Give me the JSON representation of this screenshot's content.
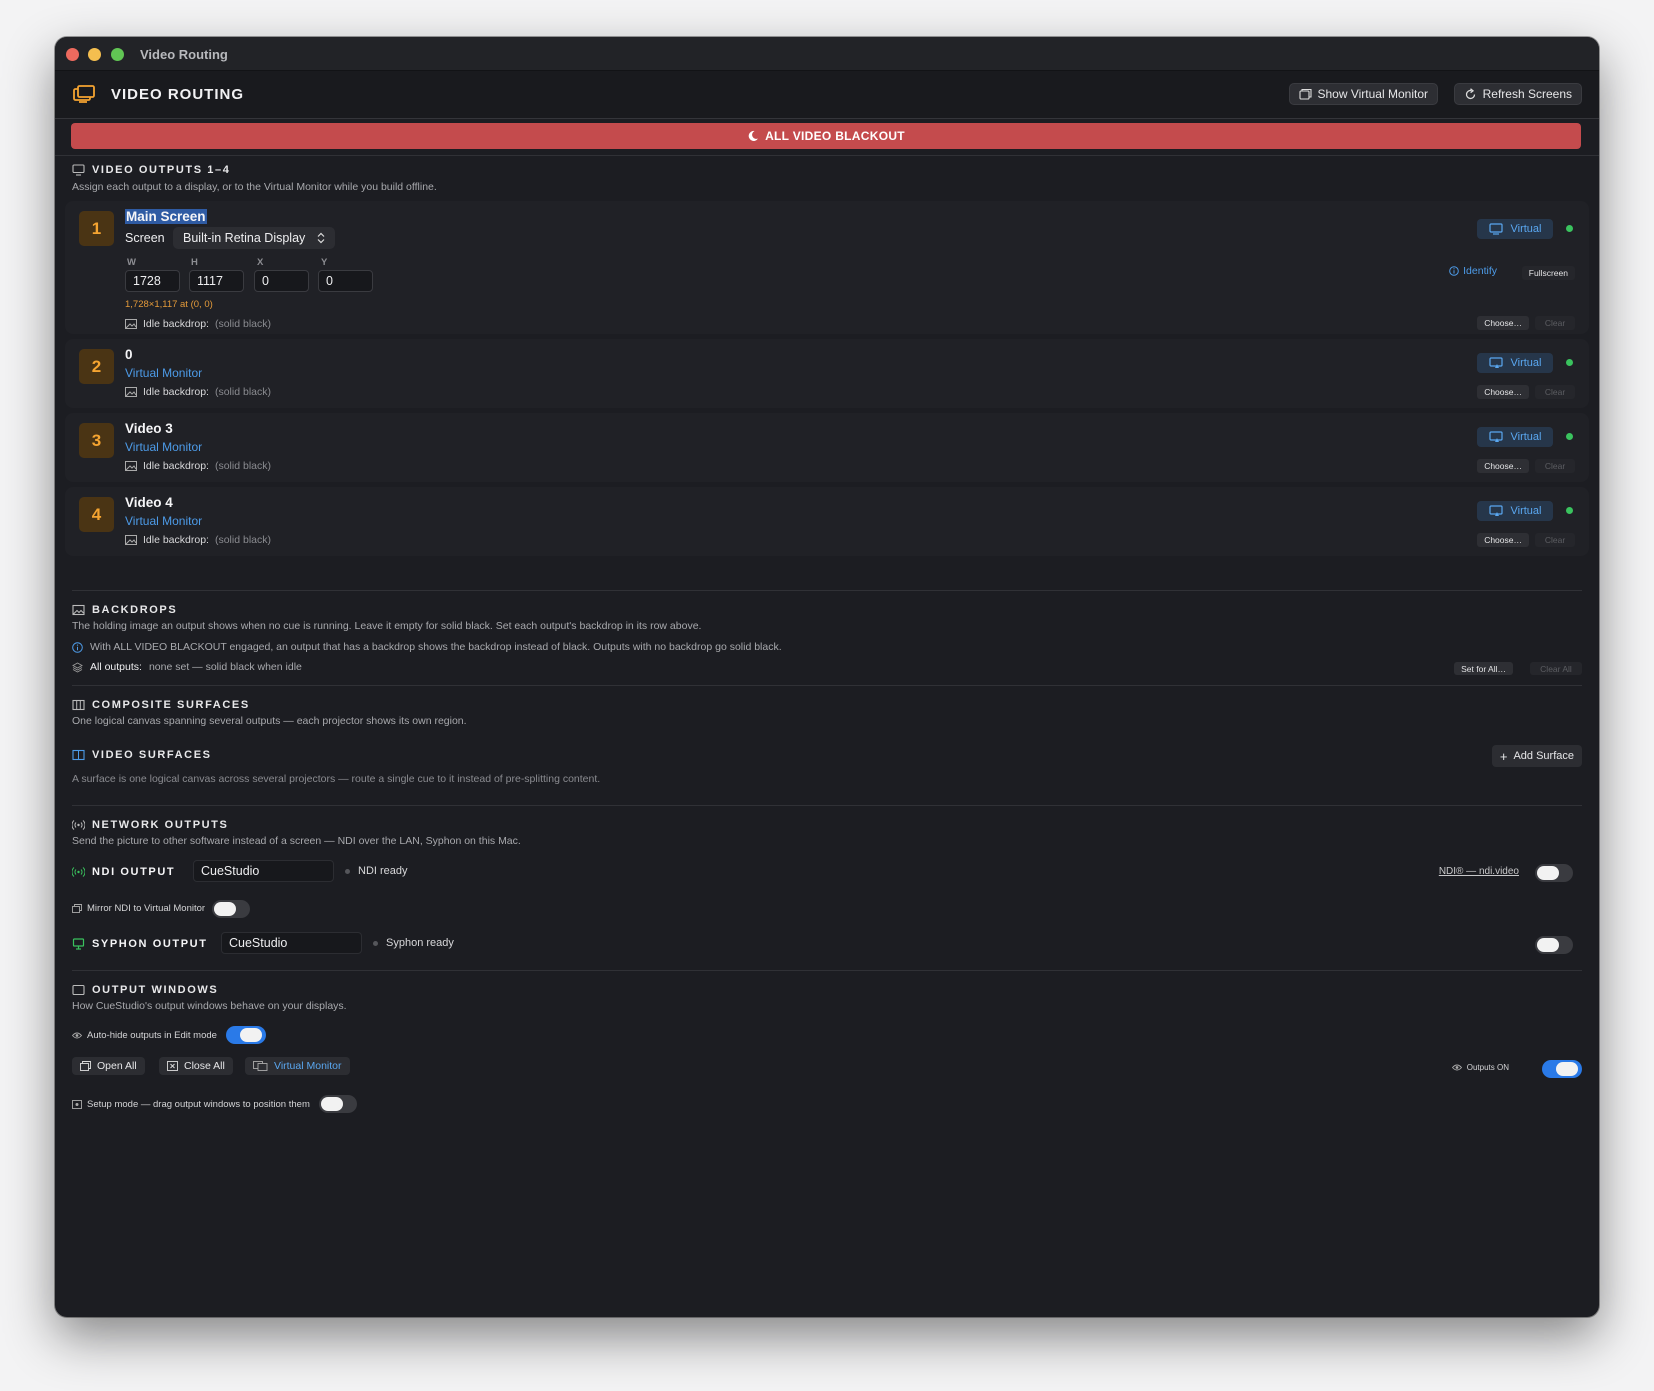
{
  "window": {
    "title": "Video Routing"
  },
  "header": {
    "title": "VIDEO ROUTING",
    "show_virtual_monitor": "Show Virtual Monitor",
    "refresh_screens": "Refresh Screens"
  },
  "blackout": {
    "label": "ALL VIDEO BLACKOUT"
  },
  "outputs_section": {
    "title": "VIDEO OUTPUTS 1–4",
    "description": "Assign each output to a display, or to the Virtual Monitor while you build offline."
  },
  "outputs": [
    {
      "number": "1",
      "name": "Main Screen",
      "screen_label": "Screen",
      "screen_value": "Built-in Retina Display",
      "w_label": "W",
      "h_label": "H",
      "x_label": "X",
      "y_label": "Y",
      "w": "1728",
      "h": "1117",
      "x": "0",
      "y": "0",
      "geometry": "1,728×1,117 at (0, 0)",
      "identify": "Identify",
      "fullscreen": "Fullscreen",
      "virtual": "Virtual",
      "idle_label": "Idle backdrop:",
      "idle_value": "(solid black)",
      "choose": "Choose…",
      "clear": "Clear"
    },
    {
      "number": "2",
      "name": "0",
      "route": "Virtual Monitor",
      "virtual": "Virtual",
      "idle_label": "Idle backdrop:",
      "idle_value": "(solid black)",
      "choose": "Choose…",
      "clear": "Clear"
    },
    {
      "number": "3",
      "name": "Video 3",
      "route": "Virtual Monitor",
      "virtual": "Virtual",
      "idle_label": "Idle backdrop:",
      "idle_value": "(solid black)",
      "choose": "Choose…",
      "clear": "Clear"
    },
    {
      "number": "4",
      "name": "Video 4",
      "route": "Virtual Monitor",
      "virtual": "Virtual",
      "idle_label": "Idle backdrop:",
      "idle_value": "(solid black)",
      "choose": "Choose…",
      "clear": "Clear"
    }
  ],
  "backdrops": {
    "title": "BACKDROPS",
    "description": "The holding image an output shows when no cue is running. Leave it empty for solid black. Set each output's backdrop in its row above.",
    "info": "With ALL VIDEO BLACKOUT engaged, an output that has a backdrop shows the backdrop instead of black. Outputs with no backdrop go solid black.",
    "all_label": "All outputs:",
    "all_value": "none set — solid black when idle",
    "set_for_all": "Set for All…",
    "clear_all": "Clear All"
  },
  "composite": {
    "title": "COMPOSITE SURFACES",
    "description": "One logical canvas spanning several outputs — each projector shows its own region."
  },
  "video_surfaces": {
    "title": "VIDEO SURFACES",
    "add_surface": "Add Surface",
    "description": "A surface is one logical canvas across several projectors — route a single cue to it instead of pre-splitting content."
  },
  "network": {
    "title": "NETWORK OUTPUTS",
    "description": "Send the picture to other software instead of a screen — NDI over the LAN, Syphon on this Mac.",
    "ndi_label": "NDI OUTPUT",
    "ndi_name": "CueStudio",
    "ndi_status": "NDI ready",
    "ndi_link": "NDI® — ndi.video",
    "mirror_label": "Mirror NDI to Virtual Monitor",
    "syphon_label": "SYPHON OUTPUT",
    "syphon_name": "CueStudio",
    "syphon_status": "Syphon ready"
  },
  "output_windows": {
    "title": "OUTPUT WINDOWS",
    "description": "How CueStudio's output windows behave on your displays.",
    "autohide": "Auto-hide outputs in Edit mode",
    "open_all": "Open All",
    "close_all": "Close All",
    "virtual_monitor": "Virtual Monitor",
    "outputs_on": "Outputs ON",
    "setup_mode": "Setup mode — drag output windows to position them"
  },
  "colors": {
    "accent": "#2a7ae8",
    "blackout": "#c44b4d",
    "badge": "#f5a431",
    "link": "#4d9be8",
    "ok": "#3ac35e"
  }
}
